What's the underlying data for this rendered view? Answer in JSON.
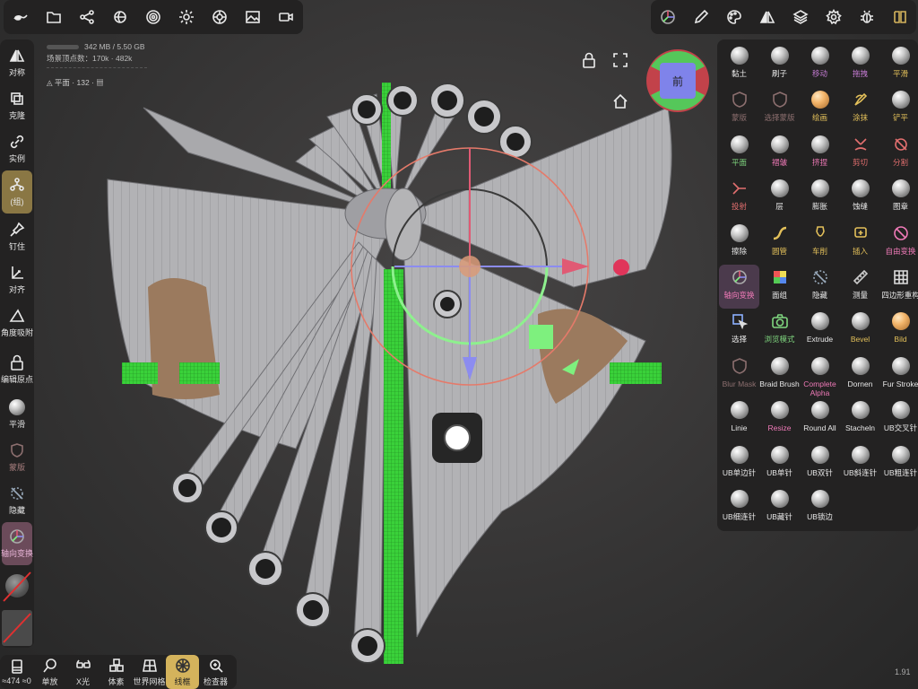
{
  "top_toolbar_left": {
    "icons": [
      "brush-stroke-icon",
      "folder-icon",
      "share-icon",
      "primitive-icon",
      "material-icon",
      "light-icon",
      "camera-settings-icon",
      "image-icon",
      "video-icon"
    ]
  },
  "top_toolbar_right": {
    "icons": [
      "axis-gizmo-icon",
      "pen-icon",
      "palette-icon",
      "symmetry-icon",
      "layers-icon",
      "settings-icon",
      "debug-icon",
      "menu-icon"
    ]
  },
  "left_toolbar": {
    "items": [
      {
        "label": "对称",
        "icon": "symmetry-icon"
      },
      {
        "label": "克隆",
        "icon": "clone-icon"
      },
      {
        "label": "实例",
        "icon": "link-icon"
      },
      {
        "label": "(组)",
        "icon": "group-icon"
      },
      {
        "label": "钉住",
        "icon": "pin-icon"
      },
      {
        "label": "对齐",
        "icon": "align-icon"
      },
      {
        "label": "角度吸附",
        "icon": "angle-icon"
      },
      {
        "label": "编辑原点",
        "icon": "lock-icon"
      },
      {
        "label": "平滑",
        "icon": "smooth-icon"
      },
      {
        "label": "蒙版",
        "icon": "mask-icon"
      },
      {
        "label": "隐藏",
        "icon": "hide-icon"
      },
      {
        "label": "轴向变换",
        "icon": "gizmo-icon"
      }
    ]
  },
  "stats": {
    "memory": "342 MB / 5.50 GB",
    "vertices_label": "场景顶点数：170k · ",
    "vertices_link": "482k"
  },
  "plane": {
    "name": "平面",
    "count": "· 132 ·"
  },
  "view_cube": {
    "label": "前"
  },
  "brushes": [
    {
      "label": "黏土",
      "color": "w"
    },
    {
      "label": "刷子",
      "color": "w"
    },
    {
      "label": "移动",
      "color": "p"
    },
    {
      "label": "拖拽",
      "color": "p"
    },
    {
      "label": "平滑",
      "color": "y"
    },
    {
      "label": "蒙版",
      "color": "d",
      "icon": "shield"
    },
    {
      "label": "选择蒙版",
      "color": "d",
      "icon": "shield"
    },
    {
      "label": "绘画",
      "color": "y",
      "ball": "orange"
    },
    {
      "label": "涂抹",
      "color": "y",
      "icon": "smudge"
    },
    {
      "label": "铲平",
      "color": "y"
    },
    {
      "label": "平面",
      "color": "g"
    },
    {
      "label": "褶皱",
      "color": "pk"
    },
    {
      "label": "挤捏",
      "color": "pk"
    },
    {
      "label": "剪切",
      "color": "r",
      "icon": "cut"
    },
    {
      "label": "分割",
      "color": "r",
      "icon": "split"
    },
    {
      "label": "投射",
      "color": "r",
      "icon": "project"
    },
    {
      "label": "层",
      "color": "w"
    },
    {
      "label": "膨胀",
      "color": "w"
    },
    {
      "label": "蚀缝",
      "color": "w"
    },
    {
      "label": "图章",
      "color": "w"
    },
    {
      "label": "擦除",
      "color": "w"
    },
    {
      "label": "圆管",
      "color": "y",
      "icon": "tube"
    },
    {
      "label": "车削",
      "color": "y",
      "icon": "lathe"
    },
    {
      "label": "插入",
      "color": "y",
      "icon": "insert"
    },
    {
      "label": "自由变换",
      "color": "pk",
      "icon": "freeform"
    },
    {
      "label": "轴向变换",
      "color": "pk",
      "icon": "gizmo",
      "selected": true
    },
    {
      "label": "面组",
      "color": "w",
      "icon": "facegroup"
    },
    {
      "label": "隐藏",
      "color": "w",
      "icon": "hide"
    },
    {
      "label": "测量",
      "color": "w",
      "icon": "ruler"
    },
    {
      "label": "四边形重构",
      "color": "w",
      "icon": "grid"
    },
    {
      "label": "选择",
      "color": "w",
      "icon": "select"
    },
    {
      "label": "浏览模式",
      "color": "g",
      "icon": "camera"
    },
    {
      "label": "Extrude",
      "color": "w"
    },
    {
      "label": "Bevel",
      "color": "y"
    },
    {
      "label": "Bild",
      "color": "y",
      "ball": "orange"
    },
    {
      "label": "Blur Mask",
      "color": "d",
      "icon": "shield"
    },
    {
      "label": "Braid Brush",
      "color": "w"
    },
    {
      "label": "Complete Alpha",
      "color": "pk"
    },
    {
      "label": "Dornen",
      "color": "w"
    },
    {
      "label": "Fur Stroke",
      "color": "w"
    },
    {
      "label": "Linie",
      "color": "w"
    },
    {
      "label": "Resize",
      "color": "pk"
    },
    {
      "label": "Round All",
      "color": "w"
    },
    {
      "label": "Stacheln",
      "color": "w"
    },
    {
      "label": "UB交叉针",
      "color": "w"
    },
    {
      "label": "UB单边针",
      "color": "w"
    },
    {
      "label": "UB单针",
      "color": "w"
    },
    {
      "label": "UB双针",
      "color": "w"
    },
    {
      "label": "UB斜连针",
      "color": "w"
    },
    {
      "label": "UB粗连针",
      "color": "w"
    },
    {
      "label": "UB细连针",
      "color": "w"
    },
    {
      "label": "UB藏针",
      "color": "w"
    },
    {
      "label": "UB锁边",
      "color": "w"
    }
  ],
  "bottom_toolbar": {
    "items": [
      {
        "label": "≈474 ≈0",
        "icon": "stack-icon"
      },
      {
        "label": "单放",
        "icon": "zoom-icon"
      },
      {
        "label": "X光",
        "icon": "xray-icon"
      },
      {
        "label": "体素",
        "icon": "voxel-icon"
      },
      {
        "label": "世界网格",
        "icon": "world-grid-icon"
      },
      {
        "label": "线框",
        "icon": "wireframe-icon",
        "active": true
      },
      {
        "label": "检查器",
        "icon": "inspector-icon"
      }
    ]
  },
  "version": "1.91",
  "colors": {
    "accent": "#d4b35c",
    "selected": "#4b3a4c",
    "mesh": "#b4b4b6",
    "green": "#33cc33",
    "ring": "#e57a6a"
  }
}
